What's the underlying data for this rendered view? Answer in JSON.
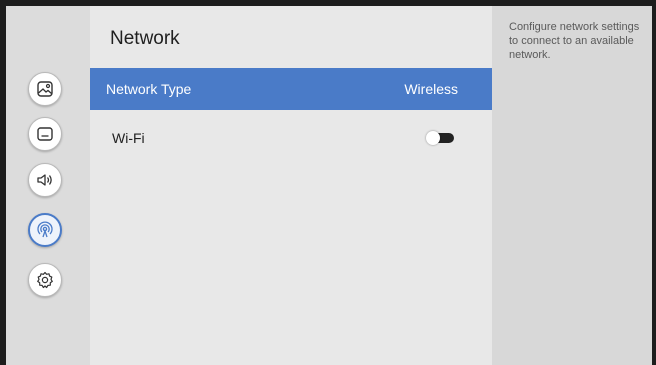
{
  "page": {
    "title": "Network"
  },
  "sidebar": {
    "items": [
      {
        "icon": "picture-icon",
        "active": false
      },
      {
        "icon": "screen-icon",
        "active": false
      },
      {
        "icon": "speaker-icon",
        "active": false
      },
      {
        "icon": "network-icon",
        "active": true
      },
      {
        "icon": "gear-icon",
        "active": false
      }
    ]
  },
  "settings": {
    "network_type": {
      "label": "Network Type",
      "value": "Wireless"
    },
    "wifi": {
      "label": "Wi-Fi",
      "enabled": false
    }
  },
  "help": {
    "text": "Configure network settings to connect to an available network."
  },
  "colors": {
    "accent": "#4a7bc8",
    "background": "#e8e8e8",
    "help_panel": "#d8d8d8"
  }
}
